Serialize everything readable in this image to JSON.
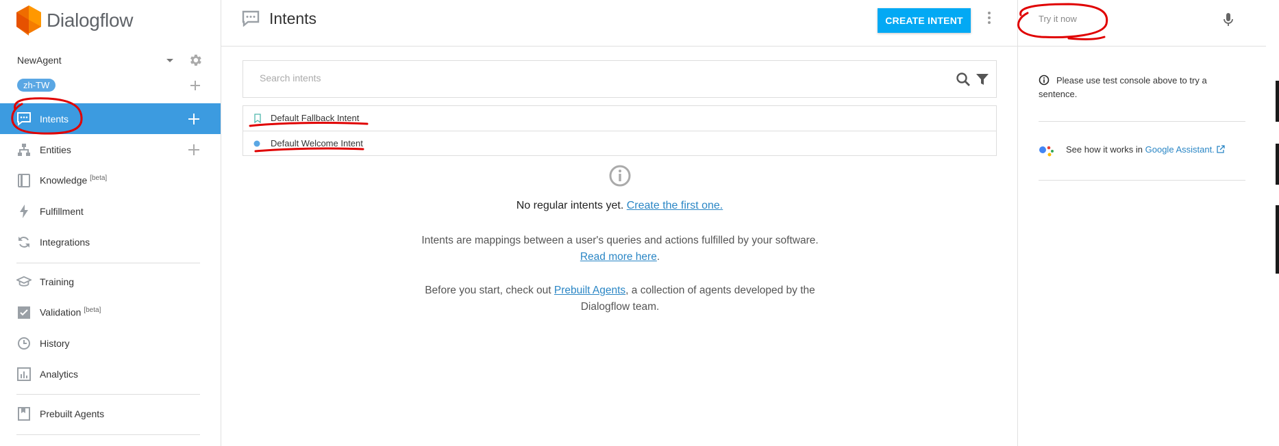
{
  "brand": {
    "name": "Dialogflow"
  },
  "agent": {
    "name": "NewAgent",
    "language": "zh-TW"
  },
  "sidebar": {
    "items": [
      {
        "label": "Intents",
        "icon": "chat-bubble-icon",
        "badge": ""
      },
      {
        "label": "Entities",
        "icon": "hierarchy-icon",
        "badge": ""
      },
      {
        "label": "Knowledge",
        "icon": "book-icon",
        "badge": "[beta]"
      },
      {
        "label": "Fulfillment",
        "icon": "bolt-icon",
        "badge": ""
      },
      {
        "label": "Integrations",
        "icon": "sync-icon",
        "badge": ""
      },
      {
        "label": "Training",
        "icon": "graduation-cap-icon",
        "badge": ""
      },
      {
        "label": "Validation",
        "icon": "checkbox-icon",
        "badge": "[beta]"
      },
      {
        "label": "History",
        "icon": "clock-icon",
        "badge": ""
      },
      {
        "label": "Analytics",
        "icon": "bar-chart-icon",
        "badge": ""
      },
      {
        "label": "Prebuilt Agents",
        "icon": "bookmark-book-icon",
        "badge": ""
      }
    ]
  },
  "main": {
    "title": "Intents",
    "create_button": "CREATE INTENT",
    "search_placeholder": "Search intents",
    "intents": [
      {
        "name": "Default Fallback Intent",
        "marker": "bookmark"
      },
      {
        "name": "Default Welcome Intent",
        "marker": "dot"
      }
    ],
    "empty": {
      "title": "No regular intents yet.",
      "title_link": "Create the first one.",
      "desc": "Intents are mappings between a user's queries and actions fulfilled by your software.",
      "desc_link": "Read more here",
      "desc_end": ".",
      "prebuilt_pre": "Before you start, check out",
      "prebuilt_link": "Prebuilt Agents",
      "prebuilt_post": ", a collection of agents developed by the Dialogflow team."
    }
  },
  "console": {
    "placeholder": "Try it now",
    "note": "Please use test console above to try a sentence.",
    "ga_text": "See how it works in",
    "ga_link": "Google Assistant."
  },
  "colors": {
    "active_nav": "#3c9be0",
    "accent": "#03a9f4",
    "link": "#2a86c5",
    "logo_orange": "#f29111",
    "annotation": "#e00000"
  }
}
